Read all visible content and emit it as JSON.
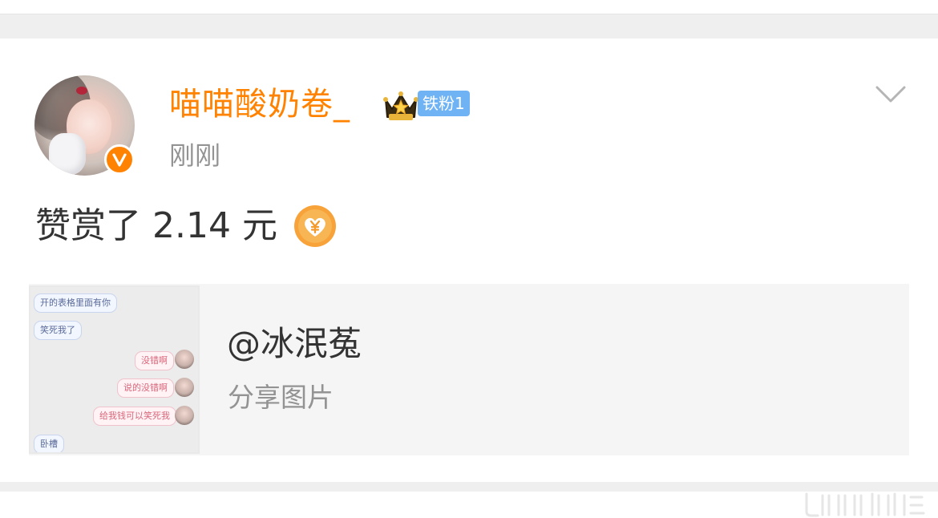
{
  "post": {
    "author": {
      "name": "喵喵酸奶卷_",
      "avatar": "user-avatar",
      "verified": true,
      "fan_badge": "铁粉1",
      "crown": "crown-icon"
    },
    "timestamp": "刚刚",
    "text": "赞赏了 2.14 元",
    "reward_icon": "heart-coin-icon",
    "shared": {
      "title": "@冰泯菟",
      "subtitle": "分享图片",
      "thumbnail": {
        "bubbles_left": [
          "开的表格里面有你",
          "笑死我了",
          "卧槽"
        ],
        "bubbles_right": [
          "没错啊",
          "说的没错啊",
          "给我钱可以笑死我"
        ]
      }
    }
  },
  "colors": {
    "brand_orange": "#ff8200",
    "fan_badge_blue": "#6fb3f4",
    "meta_gray": "#939393",
    "text_dark": "#333333",
    "share_bg": "#f5f5f5",
    "page_bg": "#efefef"
  }
}
